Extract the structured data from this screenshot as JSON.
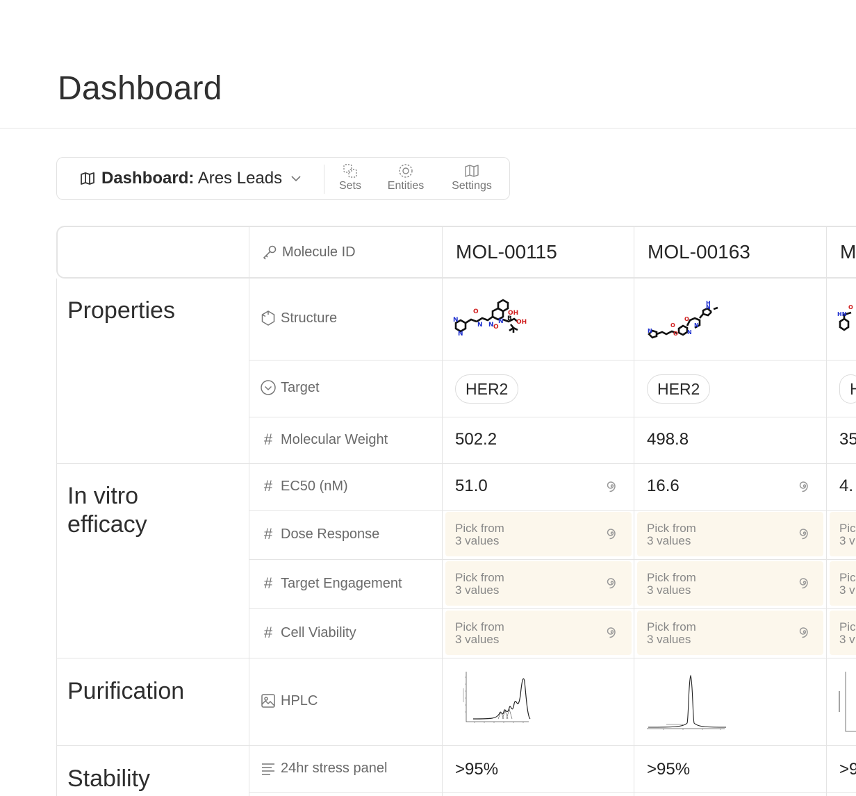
{
  "page": {
    "title": "Dashboard"
  },
  "toolbar": {
    "dashboard_prefix": "Dashboard:",
    "dashboard_name": "Ares Leads",
    "buttons": [
      {
        "label": "Sets",
        "icon": "sets-icon"
      },
      {
        "label": "Entities",
        "icon": "entities-icon"
      },
      {
        "label": "Settings",
        "icon": "settings-map-icon"
      }
    ]
  },
  "table": {
    "header": {
      "attribute_label": "Molecule ID",
      "molecules": [
        "MOL-00115",
        "MOL-00163",
        "M"
      ]
    },
    "sections": {
      "properties": "Properties",
      "in_vitro": "In vitro efficacy",
      "purification": "Purification",
      "stability": "Stability"
    },
    "attributes": {
      "structure": "Structure",
      "target": "Target",
      "molecular_weight": "Molecular Weight",
      "ec50": "EC50 (nM)",
      "dose_response": "Dose Response",
      "target_engagement": "Target Engagement",
      "cell_viability": "Cell Viability",
      "hplc": "HPLC",
      "stress_panel": "24hr stress panel"
    },
    "values": {
      "target": [
        "HER2",
        "HER2",
        "H"
      ],
      "molecular_weight": [
        "502.2",
        "498.8",
        "35"
      ],
      "ec50": [
        "51.0",
        "16.6",
        "4."
      ],
      "pick_line1": "Pick from",
      "pick_line2": "3 values",
      "pick_line1_clipped": "Pic",
      "pick_line2_clipped": "3 v",
      "stress_panel": [
        ">95%",
        ">95%",
        ">9"
      ]
    }
  },
  "colors": {
    "pick_bg": "#fcf7ec",
    "border": "#e4e4e4"
  }
}
